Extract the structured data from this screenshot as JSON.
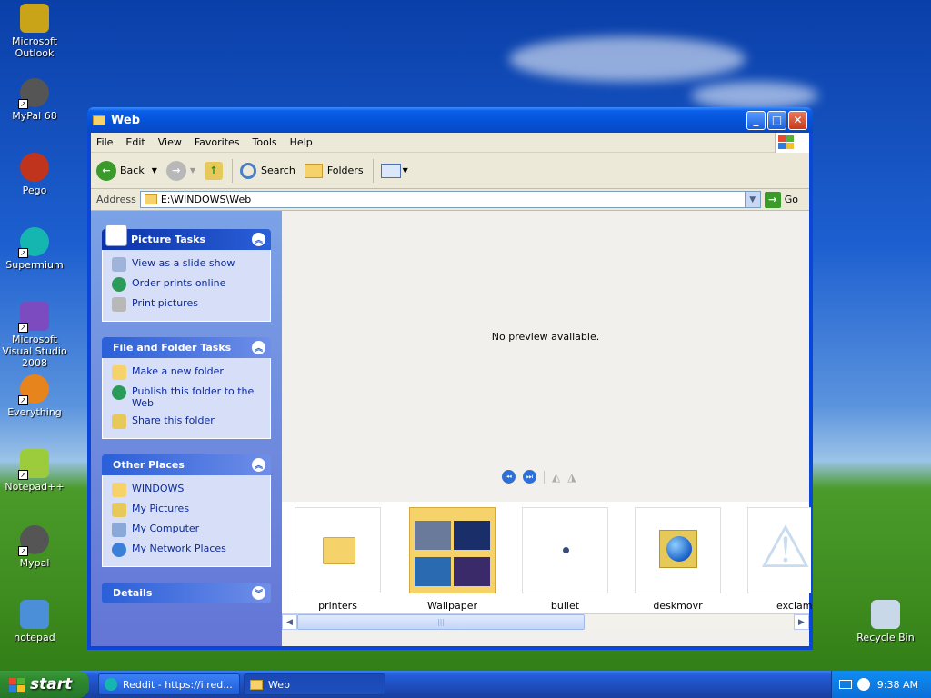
{
  "desktop": {
    "icons": [
      {
        "label": "Microsoft Outlook",
        "icon": "outlook-icon",
        "color": "#c9a418"
      },
      {
        "label": "MyPal 68",
        "icon": "raccoon-icon",
        "color": "#555555"
      },
      {
        "label": "Pego",
        "icon": "pego-icon",
        "color": "#c0341e"
      },
      {
        "label": "Supermium",
        "icon": "supermium-icon",
        "color": "#16b6b0"
      },
      {
        "label": "Microsoft Visual Studio 2008",
        "icon": "visual-studio-icon",
        "color": "#7b4bbf"
      },
      {
        "label": "Everything",
        "icon": "everything-icon",
        "color": "#e8841c"
      },
      {
        "label": "Notepad++",
        "icon": "notepadpp-icon",
        "color": "#9ccc3c"
      },
      {
        "label": "Mypal",
        "icon": "raccoon-icon",
        "color": "#555555"
      },
      {
        "label": "notepad",
        "icon": "notepad-icon",
        "color": "#4a8fd8"
      }
    ],
    "recycle_bin": "Recycle Bin"
  },
  "window": {
    "title": "Web",
    "menu": [
      "File",
      "Edit",
      "View",
      "Favorites",
      "Tools",
      "Help"
    ],
    "toolbar": {
      "back": "Back",
      "search": "Search",
      "folders": "Folders"
    },
    "address": {
      "label": "Address",
      "value": "E:\\WINDOWS\\Web",
      "go": "Go"
    }
  },
  "sidebar": {
    "picture_tasks": {
      "title": "Picture Tasks",
      "items": [
        "View as a slide show",
        "Order prints online",
        "Print pictures"
      ]
    },
    "file_folder_tasks": {
      "title": "File and Folder Tasks",
      "items": [
        "Make a new folder",
        "Publish this folder to the Web",
        "Share this folder"
      ]
    },
    "other_places": {
      "title": "Other Places",
      "items": [
        "WINDOWS",
        "My Pictures",
        "My Computer",
        "My Network Places"
      ]
    },
    "details": {
      "title": "Details"
    }
  },
  "preview": {
    "message": "No preview available."
  },
  "files": [
    "printers",
    "Wallpaper",
    "bullet",
    "deskmovr",
    "exclam"
  ],
  "taskbar": {
    "start": "start",
    "tasks": [
      "Reddit - https://i.red...",
      "Web"
    ],
    "clock": "9:38 AM"
  }
}
